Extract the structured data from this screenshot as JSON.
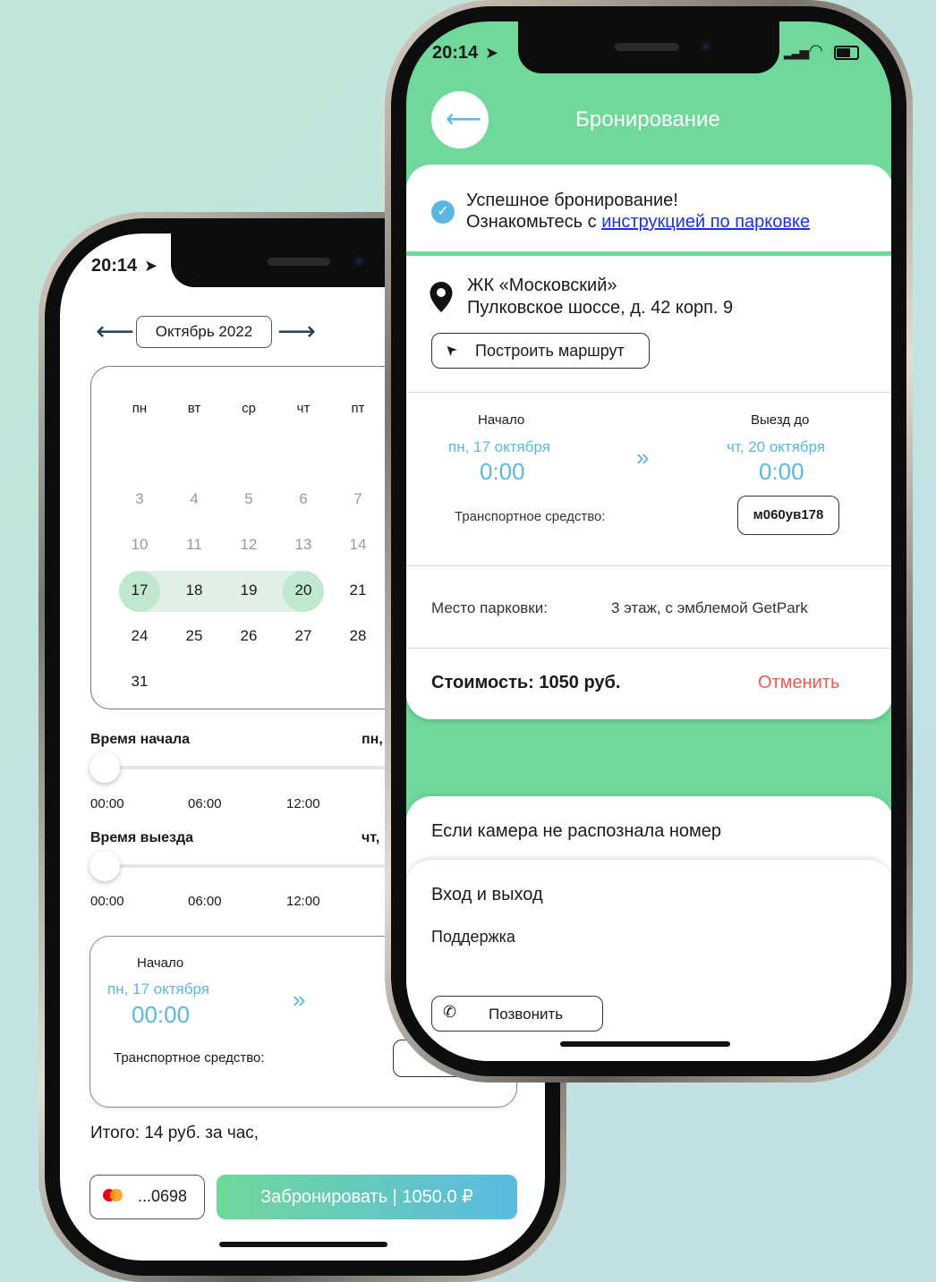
{
  "colors": {
    "accent_green": "#6fd89a",
    "accent_blue": "#5ab8e0",
    "cancel_red": "#f0584a",
    "selected_day": "#bfe8cf"
  },
  "left_phone": {
    "status_time": "20:14",
    "month_label": "Октябрь 2022",
    "weekdays": [
      "пн",
      "вт",
      "ср",
      "чт",
      "пт"
    ],
    "weeks": [
      [
        "3",
        "4",
        "5",
        "6",
        "7"
      ],
      [
        "10",
        "11",
        "12",
        "13",
        "14"
      ],
      [
        "17",
        "18",
        "19",
        "20",
        "21"
      ],
      [
        "24",
        "25",
        "26",
        "27",
        "28"
      ],
      [
        "31"
      ]
    ],
    "selected_start": "17",
    "selected_end": "20",
    "start_time": {
      "label": "Время начала",
      "value_prefix": "пн,",
      "ticks": [
        "00:00",
        "06:00",
        "12:00"
      ],
      "slider_fraction": 0
    },
    "end_time": {
      "label": "Время выезда",
      "value_prefix": "чт,",
      "ticks": [
        "00:00",
        "06:00",
        "12:00"
      ],
      "slider_fraction": 0
    },
    "summary": {
      "start_label": "Начало",
      "start_date": "пн, 17 октября",
      "start_time": "00:00",
      "vehicle_label": "Транспортное средство:"
    },
    "total": "Итого: 14 руб. за час,",
    "card": "...0698",
    "book_button": "Забронировать | 1050.0 ₽"
  },
  "right_phone": {
    "status_time": "20:14",
    "title": "Бронирование",
    "success_line": "Успешное бронирование!",
    "instruction_prefix": "Ознакомьтесь с",
    "instruction_link": "инструкцией по парковке",
    "place_name": "ЖК «Московский»",
    "address": "Пулковское шоссе, д. 42 корп. 9",
    "route_button": "Построить маршрут",
    "start_label": "Начало",
    "start_date": "пн, 17 октября",
    "start_time": "0:00",
    "end_label": "Выезд до",
    "end_date": "чт, 20 октября",
    "end_time": "0:00",
    "vehicle_label": "Транспортное средство:",
    "vehicle_plate": "м060ув178",
    "spot_label": "Место парковки:",
    "spot_value": "3 этаж, с эмблемой GetPark",
    "cost": "Стоимость: 1050 руб.",
    "cancel": "Отменить",
    "camera_title": "Если камера не распознала номер",
    "entry_title": "Вход и выход",
    "support": "Поддержка",
    "call_button": "Позвонить"
  }
}
